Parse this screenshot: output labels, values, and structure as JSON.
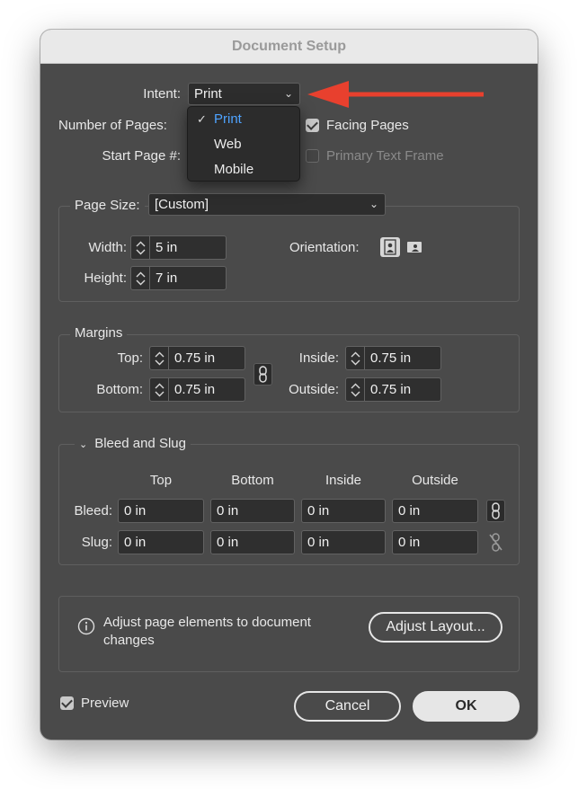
{
  "dialog": {
    "title": "Document Setup"
  },
  "intent": {
    "label": "Intent:",
    "value": "Print",
    "menu_options": [
      "Print",
      "Web",
      "Mobile"
    ]
  },
  "pages": {
    "number_label": "Number of Pages:",
    "start_label": "Start Page #:",
    "facing_pages_label": "Facing Pages",
    "facing_pages_checked": true,
    "primary_text_frame_label": "Primary Text Frame",
    "primary_text_frame_checked": false
  },
  "page_size": {
    "label": "Page Size:",
    "value": "[Custom]",
    "width_label": "Width:",
    "width_value": "5 in",
    "height_label": "Height:",
    "height_value": "7 in",
    "orientation_label": "Orientation:"
  },
  "margins": {
    "legend": "Margins",
    "top_label": "Top:",
    "top_value": "0.75 in",
    "bottom_label": "Bottom:",
    "bottom_value": "0.75 in",
    "inside_label": "Inside:",
    "inside_value": "0.75 in",
    "outside_label": "Outside:",
    "outside_value": "0.75 in"
  },
  "bleed_slug": {
    "legend": "Bleed and Slug",
    "columns": [
      "Top",
      "Bottom",
      "Inside",
      "Outside"
    ],
    "bleed_label": "Bleed:",
    "bleed_values": [
      "0 in",
      "0 in",
      "0 in",
      "0 in"
    ],
    "slug_label": "Slug:",
    "slug_values": [
      "0 in",
      "0 in",
      "0 in",
      "0 in"
    ]
  },
  "adjust": {
    "message": "Adjust page elements to document",
    "message_line2": "changes",
    "button_label": "Adjust Layout..."
  },
  "footer": {
    "preview_label": "Preview",
    "preview_checked": true,
    "cancel_label": "Cancel",
    "ok_label": "OK"
  },
  "colors": {
    "dialog_bg": "#4a4a4a",
    "field_bg": "#2f2f2f",
    "selected_menu_text": "#4ea3ff",
    "annotation_arrow": "#e8402e"
  }
}
